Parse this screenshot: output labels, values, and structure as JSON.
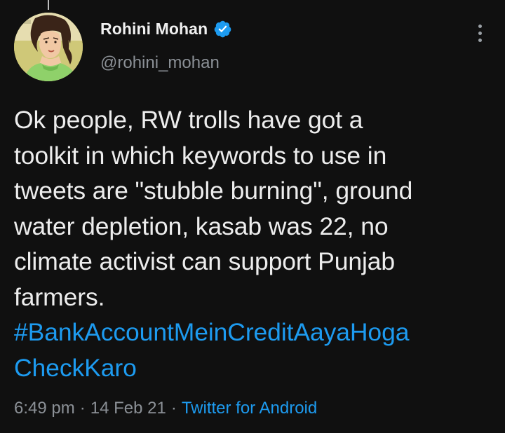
{
  "tweet": {
    "author": {
      "display_name": "Rohini Mohan",
      "handle": "@rohini_mohan",
      "verified": true,
      "avatar_icon": "illustrated-woman-avatar"
    },
    "more_icon": "more-vertical-icon",
    "text_lines": [
      "Ok people, RW trolls have got a",
      "toolkit in which keywords to use in",
      "tweets are \"stubble burning\", ground",
      "water depletion, kasab was 22, no",
      "climate activist can support Punjab",
      "farmers."
    ],
    "hashtag_lines": [
      "#BankAccountMeinCreditAayaHoga",
      "CheckKaro"
    ],
    "time": "6:49 pm",
    "separator": "·",
    "date": "14 Feb 21",
    "source": "Twitter for Android"
  },
  "colors": {
    "background": "#101010",
    "text": "#ededed",
    "secondary": "#8b9096",
    "link": "#1d9bf0",
    "verified": "#1d9bf0"
  }
}
